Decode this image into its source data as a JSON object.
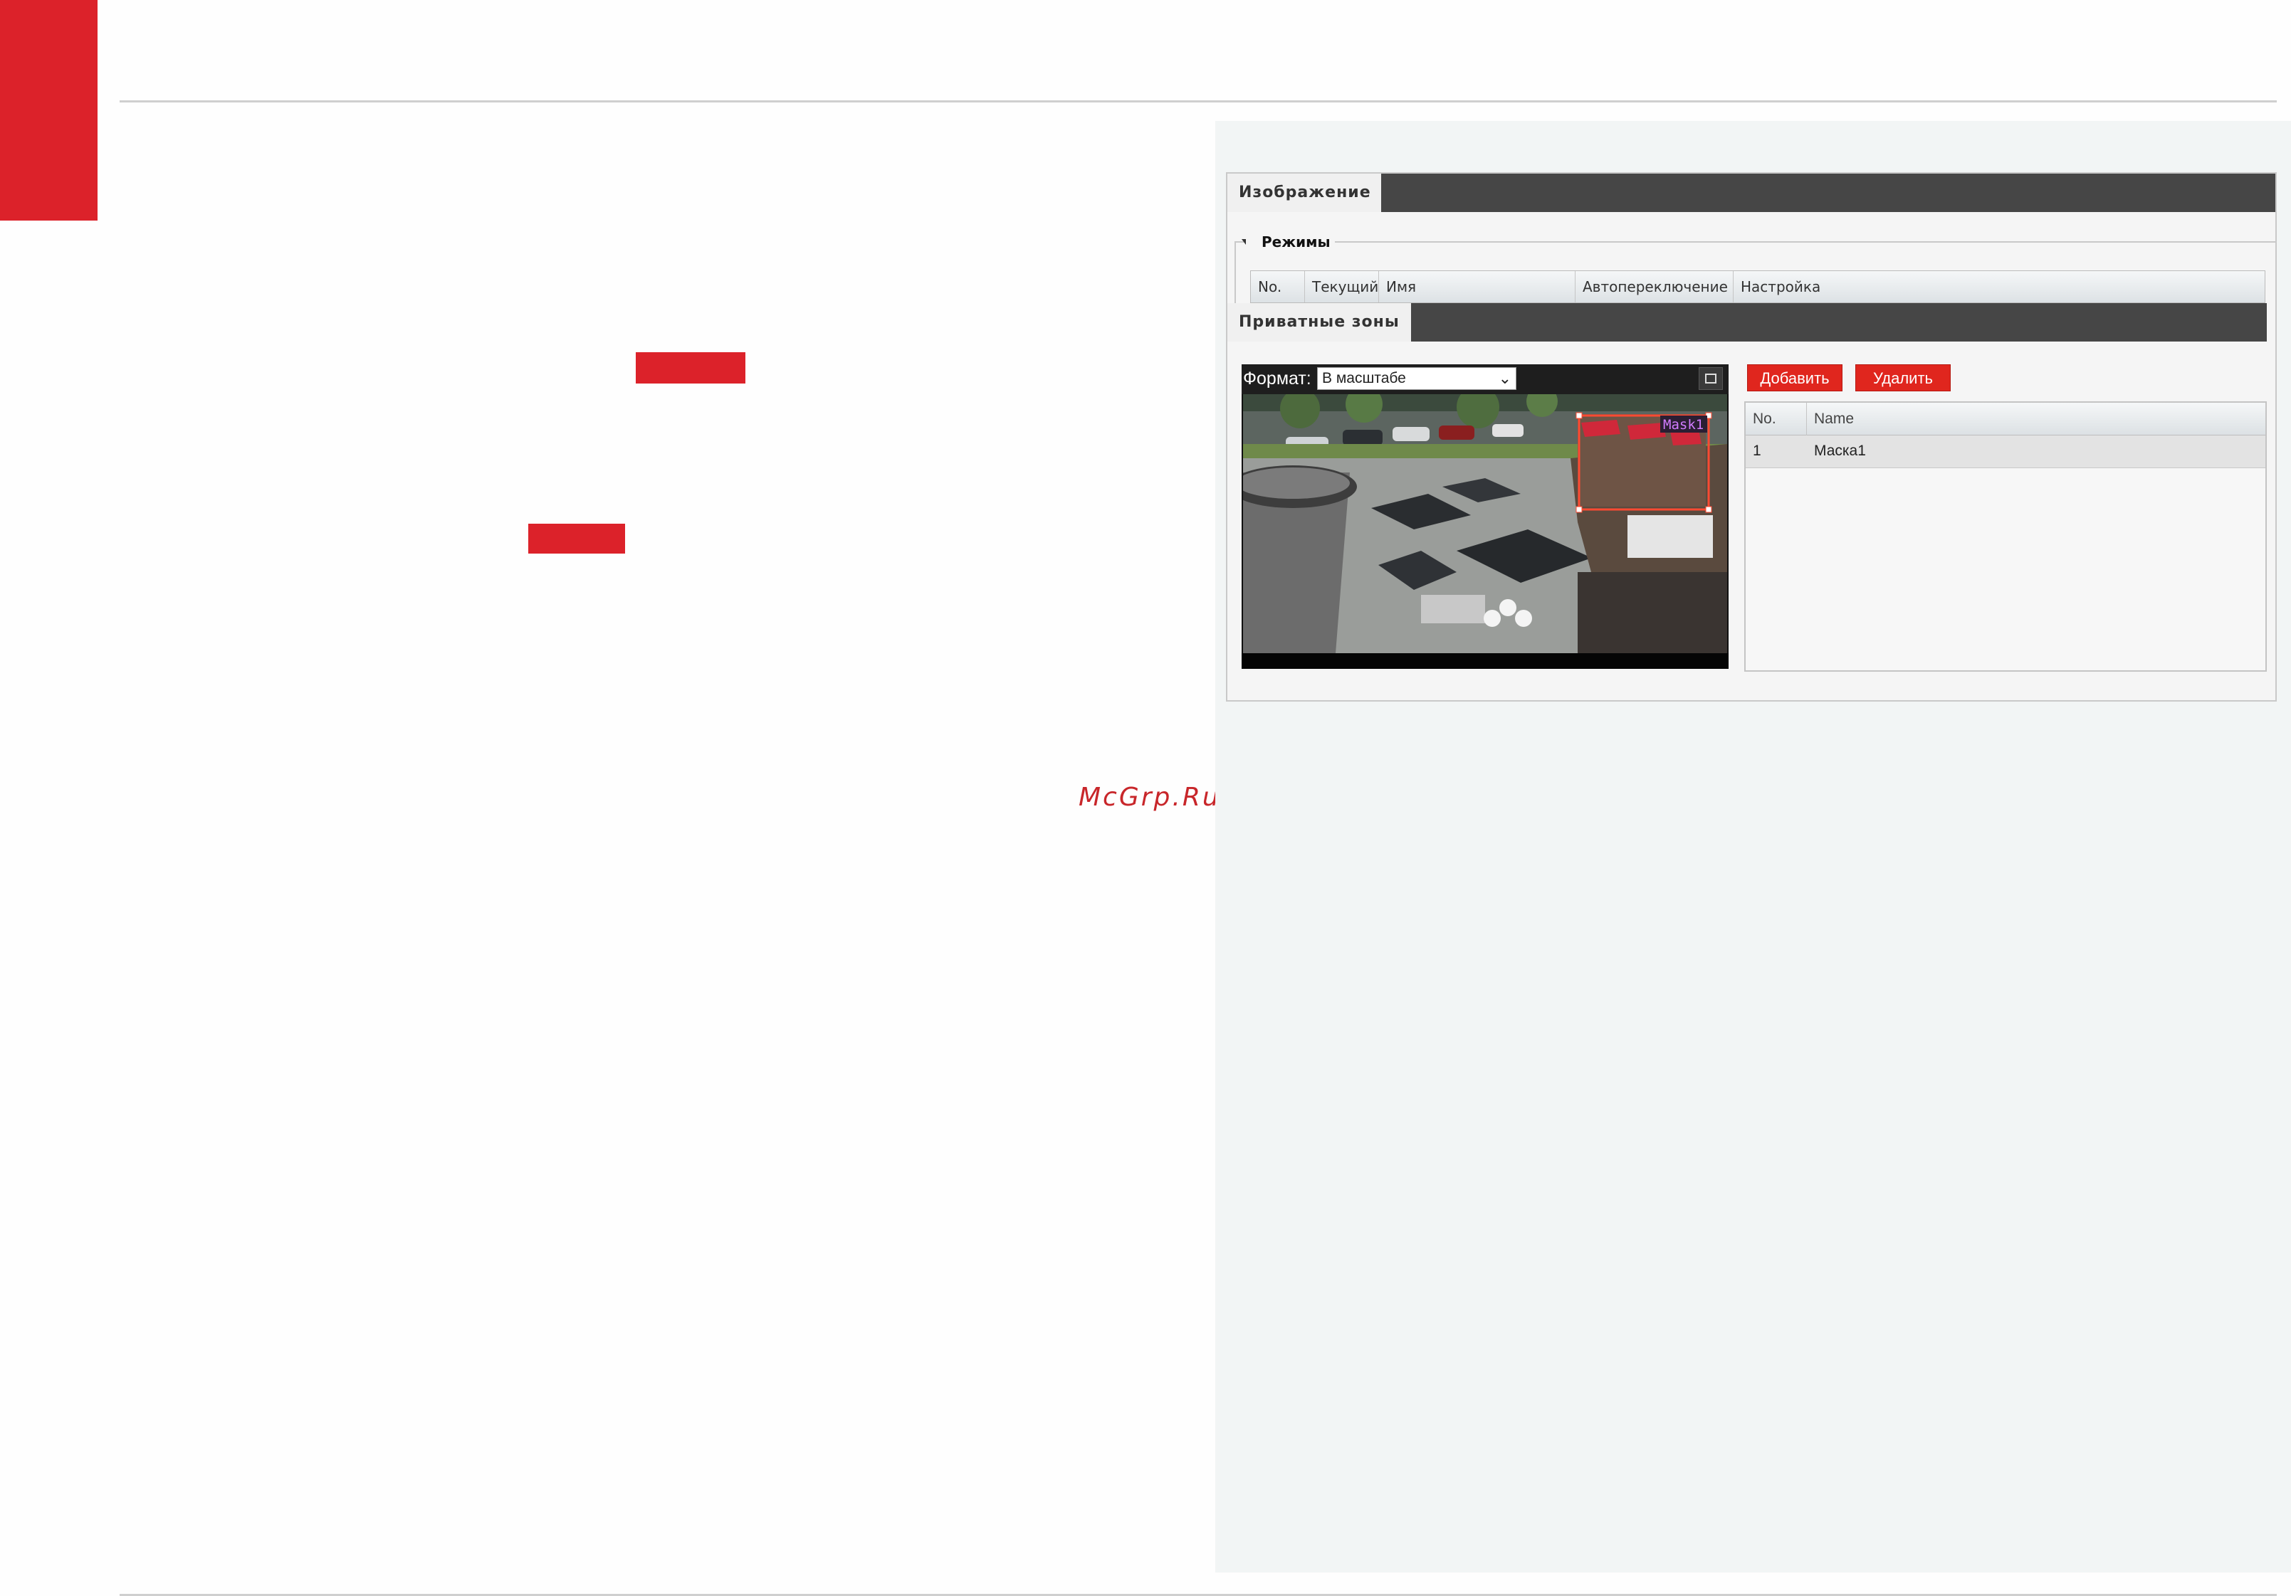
{
  "watermark": "McGrp.Ru",
  "colors": {
    "accent": "#dc222a",
    "button_red": "#e0261e",
    "tab_bar": "#464646",
    "panel_bg": "#f2f5f5"
  },
  "screenshot": {
    "image_tab": {
      "label": "Изображение"
    },
    "modes": {
      "legend": "Режимы",
      "columns": [
        "No.",
        "Текущий",
        "Имя",
        "Автопереключение",
        "Настройка"
      ]
    },
    "privacy_tab": {
      "label": "Приватные зоны"
    },
    "video": {
      "format_label": "Формат:",
      "format_value": "В масштабе",
      "mask_overlay_label": "Mask1"
    },
    "buttons": {
      "add": "Добавить",
      "delete": "Удалить"
    },
    "mask_list": {
      "columns": [
        "No.",
        "Name"
      ],
      "rows": [
        {
          "no": "1",
          "name": "Маска1"
        }
      ]
    }
  }
}
